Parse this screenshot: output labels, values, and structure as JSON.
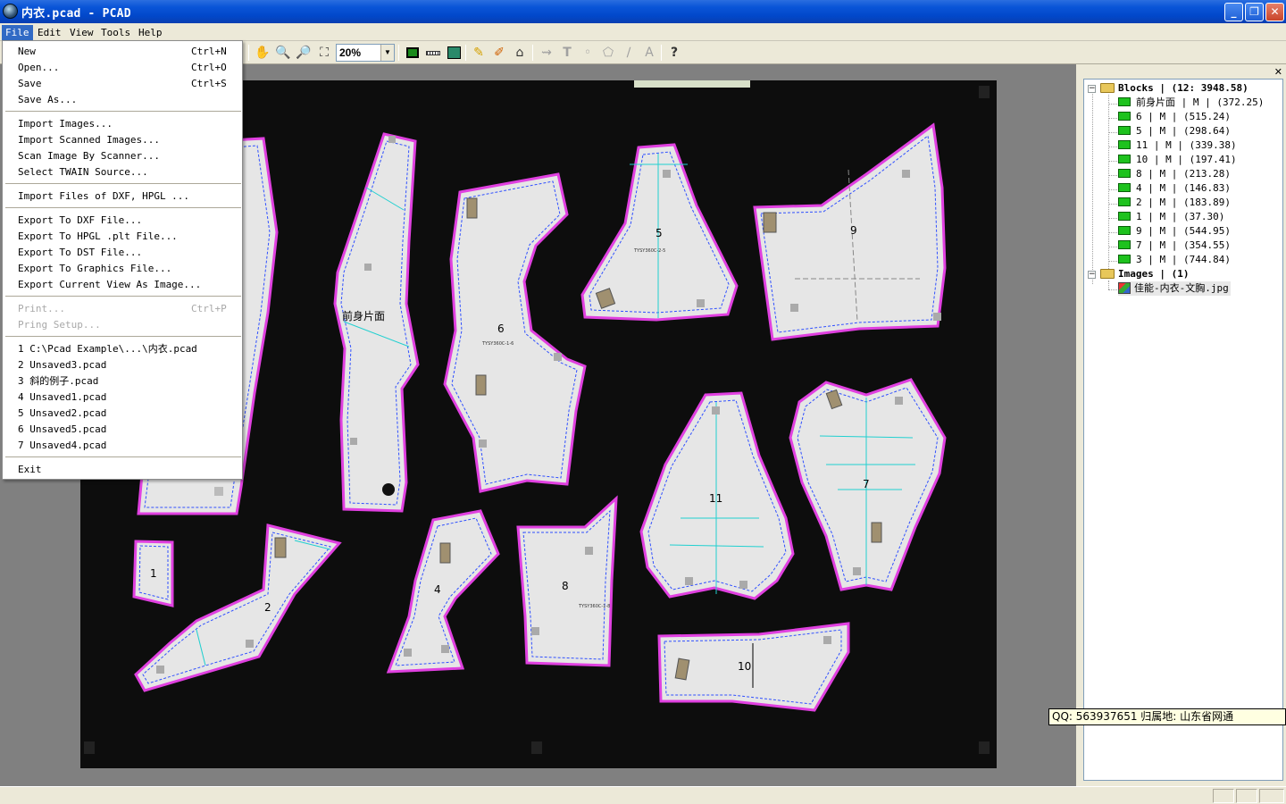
{
  "window": {
    "title": "内衣.pcad - PCAD",
    "buttons": {
      "minimize": "_",
      "restore": "❐",
      "close": "✕"
    }
  },
  "menubar": [
    {
      "label": "File",
      "active": true
    },
    {
      "label": "Edit"
    },
    {
      "label": "View"
    },
    {
      "label": "Tools"
    },
    {
      "label": "Help"
    }
  ],
  "toolbar": {
    "zoom_value": "20%",
    "icons": [
      "pan-hand-icon",
      "zoom-in-icon",
      "zoom-out-icon",
      "zoom-fit-icon",
      "frame-icon",
      "ruler-icon",
      "image-frame-icon",
      "brush-icon",
      "edge-brush-icon",
      "polygon-icon",
      "arrow-line-icon",
      "text-icon",
      "point-icon",
      "shape-icon",
      "pen-icon",
      "text-pen-icon",
      "help-icon"
    ]
  },
  "file_menu": {
    "groups": [
      [
        {
          "label": "New",
          "shortcut": "Ctrl+N"
        },
        {
          "label": "Open...",
          "shortcut": "Ctrl+O"
        },
        {
          "label": "Save",
          "shortcut": "Ctrl+S"
        },
        {
          "label": "Save As...",
          "shortcut": ""
        }
      ],
      [
        {
          "label": "Import Images...",
          "shortcut": ""
        },
        {
          "label": "Import Scanned Images...",
          "shortcut": ""
        },
        {
          "label": "Scan Image By Scanner...",
          "shortcut": ""
        },
        {
          "label": "Select TWAIN Source...",
          "shortcut": ""
        }
      ],
      [
        {
          "label": "Import Files of DXF, HPGL ...",
          "shortcut": ""
        }
      ],
      [
        {
          "label": "Export To DXF File...",
          "shortcut": ""
        },
        {
          "label": "Export To HPGL .plt File...",
          "shortcut": ""
        },
        {
          "label": "Export To DST File...",
          "shortcut": ""
        },
        {
          "label": "Export To Graphics File...",
          "shortcut": ""
        },
        {
          "label": "Export Current View As Image...",
          "shortcut": ""
        }
      ],
      [
        {
          "label": "Print...",
          "shortcut": "Ctrl+P",
          "disabled": true
        },
        {
          "label": "Pring Setup...",
          "shortcut": "",
          "disabled": true
        }
      ],
      [
        {
          "label": "1 C:\\Pcad Example\\...\\内衣.pcad",
          "shortcut": ""
        },
        {
          "label": "2 Unsaved3.pcad",
          "shortcut": ""
        },
        {
          "label": "3 斜的例子.pcad",
          "shortcut": ""
        },
        {
          "label": "4 Unsaved1.pcad",
          "shortcut": ""
        },
        {
          "label": "5 Unsaved2.pcad",
          "shortcut": ""
        },
        {
          "label": "6 Unsaved5.pcad",
          "shortcut": ""
        },
        {
          "label": "7 Unsaved4.pcad",
          "shortcut": ""
        }
      ],
      [
        {
          "label": "Exit",
          "shortcut": ""
        }
      ]
    ]
  },
  "tree": {
    "blocks_header": "Blocks | (12: 3948.58)",
    "blocks": [
      "前身片面 | M | (372.25)",
      "6 | M | (515.24)",
      "5 | M | (298.64)",
      "11 | M | (339.38)",
      "10 | M | (197.41)",
      "8 | M | (213.28)",
      "4 | M | (146.83)",
      "2 | M | (183.89)",
      "1 | M | (37.30)",
      "9 | M | (544.95)",
      "7 | M | (354.55)",
      "3 | M | (744.84)"
    ],
    "images_header": "Images | (1)",
    "images": [
      "佳能-内衣-文胸.jpg"
    ]
  },
  "tooltip": "QQ: 563937651 归属地: 山东省网通",
  "canvas_labels": {
    "front_piece": "前身片面",
    "p6": "6",
    "p5": "5",
    "p9": "9",
    "p11": "11",
    "p7": "7",
    "p1": "1",
    "p2": "2",
    "p4": "4",
    "p8": "8",
    "p10": "10"
  },
  "colors": {
    "outline": "#e040e0",
    "seam": "#3050ff",
    "guide": "#20d0d0",
    "paper": "#e6e6e6",
    "background": "#0d0d0d"
  }
}
